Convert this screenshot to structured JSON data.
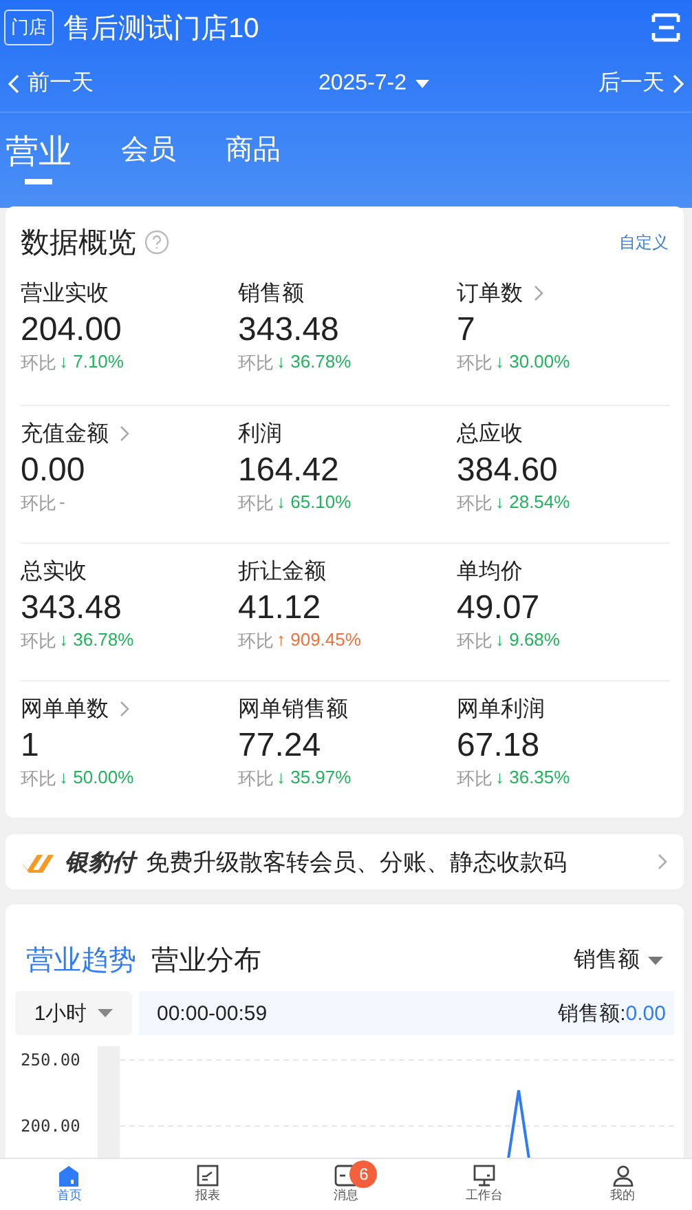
{
  "header": {
    "store_tag": "门店",
    "store_name": "售后测试门店10"
  },
  "date_nav": {
    "prev": "前一天",
    "date": "2025-7-2",
    "next": "后一天"
  },
  "tabs": [
    {
      "label": "营业",
      "selected": true
    },
    {
      "label": "会员",
      "selected": false
    },
    {
      "label": "商品",
      "selected": false
    }
  ],
  "overview": {
    "title": "数据概览",
    "customize": "自定义",
    "metrics": [
      {
        "label": "营业实收",
        "link": false,
        "value": "204.00",
        "change_label": "环比",
        "color": "#1fb35b",
        "change": "↓ 7.10%"
      },
      {
        "label": "销售额",
        "link": false,
        "value": "343.48",
        "change_label": "环比",
        "color": "#1fb35b",
        "change": "↓ 36.78%"
      },
      {
        "label": "订单数",
        "link": true,
        "value": "7",
        "change_label": "环比",
        "color": "#1fb35b",
        "change": "↓ 30.00%"
      },
      {
        "label": "充值金额",
        "link": true,
        "value": "0.00",
        "change_label": "环比",
        "color": "#999999",
        "change": "-"
      },
      {
        "label": "利润",
        "link": false,
        "value": "164.42",
        "change_label": "环比",
        "color": "#1fb35b",
        "change": "↓ 65.10%"
      },
      {
        "label": "总应收",
        "link": false,
        "value": "384.60",
        "change_label": "环比",
        "color": "#1fb35b",
        "change": "↓ 28.54%"
      },
      {
        "label": "总实收",
        "link": false,
        "value": "343.48",
        "change_label": "环比",
        "color": "#1fb35b",
        "change": "↓ 36.78%"
      },
      {
        "label": "折让金额",
        "link": false,
        "value": "41.12",
        "change_label": "环比",
        "color": "#f0703c",
        "change": "↑ 909.45%"
      },
      {
        "label": "单均价",
        "link": false,
        "value": "49.07",
        "change_label": "环比",
        "color": "#1fb35b",
        "change": "↓ 9.68%"
      },
      {
        "label": "网单单数",
        "link": true,
        "value": "1",
        "change_label": "环比",
        "color": "#1fb35b",
        "change": "↓ 50.00%"
      },
      {
        "label": "网单销售额",
        "link": false,
        "value": "77.24",
        "change_label": "环比",
        "color": "#1fb35b",
        "change": "↓ 35.97%"
      },
      {
        "label": "网单利润",
        "link": false,
        "value": "67.18",
        "change_label": "环比",
        "color": "#1fb35b",
        "change": "↓ 36.35%"
      }
    ]
  },
  "banner": {
    "brand": "银豹付",
    "text": "免费升级散客转会员、分账、静态收款码"
  },
  "trend": {
    "tabs": [
      {
        "label": "营业趋势",
        "selected": true
      },
      {
        "label": "营业分布",
        "selected": false
      }
    ],
    "metric": "销售额",
    "interval": "1小时",
    "range": "00:00-00:59",
    "reading_label": "销售额:",
    "reading_value": "0.00",
    "chart": {
      "y_labels": [
        "250.00",
        "200.00"
      ]
    }
  },
  "bottom_nav": [
    {
      "kind": "home",
      "label": "首页",
      "selected": true
    },
    {
      "kind": "report",
      "label": "报表",
      "selected": false
    },
    {
      "kind": "message",
      "label": "消息",
      "selected": false,
      "badge": "6"
    },
    {
      "kind": "workbench",
      "label": "工作台",
      "selected": false
    },
    {
      "kind": "profile",
      "label": "我的",
      "selected": false
    }
  ]
}
